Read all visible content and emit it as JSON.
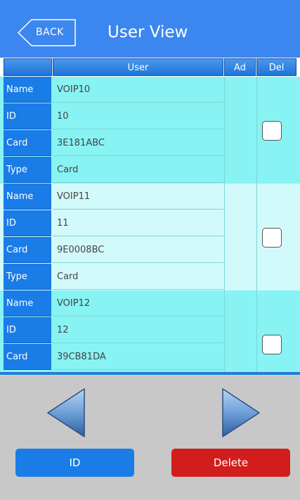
{
  "header": {
    "back_label": "BACK",
    "title": "User View"
  },
  "table": {
    "columns": {
      "user": "User",
      "ad": "Ad",
      "del": "Del"
    },
    "users": [
      {
        "rows": [
          {
            "label": "Name",
            "value": "VOIP10"
          },
          {
            "label": "ID",
            "value": "10"
          },
          {
            "label": "Card",
            "value": "3E181ABC"
          },
          {
            "label": "Type",
            "value": "Card"
          }
        ],
        "del_checked": false
      },
      {
        "rows": [
          {
            "label": "Name",
            "value": "VOIP11"
          },
          {
            "label": "ID",
            "value": "11"
          },
          {
            "label": "Card",
            "value": "9E0008BC"
          },
          {
            "label": "Type",
            "value": "Card"
          }
        ],
        "del_checked": false
      },
      {
        "rows": [
          {
            "label": "Name",
            "value": "VOIP12"
          },
          {
            "label": "ID",
            "value": "12"
          },
          {
            "label": "Card",
            "value": "39CB81DA"
          }
        ],
        "del_checked": false
      }
    ]
  },
  "navigation": {
    "prev_icon": "arrow-left-icon",
    "next_icon": "arrow-right-icon"
  },
  "footer": {
    "id_label": "ID",
    "delete_label": "Delete"
  },
  "colors": {
    "header": "#3c86f0",
    "label_cell": "#1a7ce6",
    "row_a": "#88f3f3",
    "row_b": "#d3fafa",
    "delete_button": "#d21d1d",
    "id_button": "#1a7ce6"
  }
}
